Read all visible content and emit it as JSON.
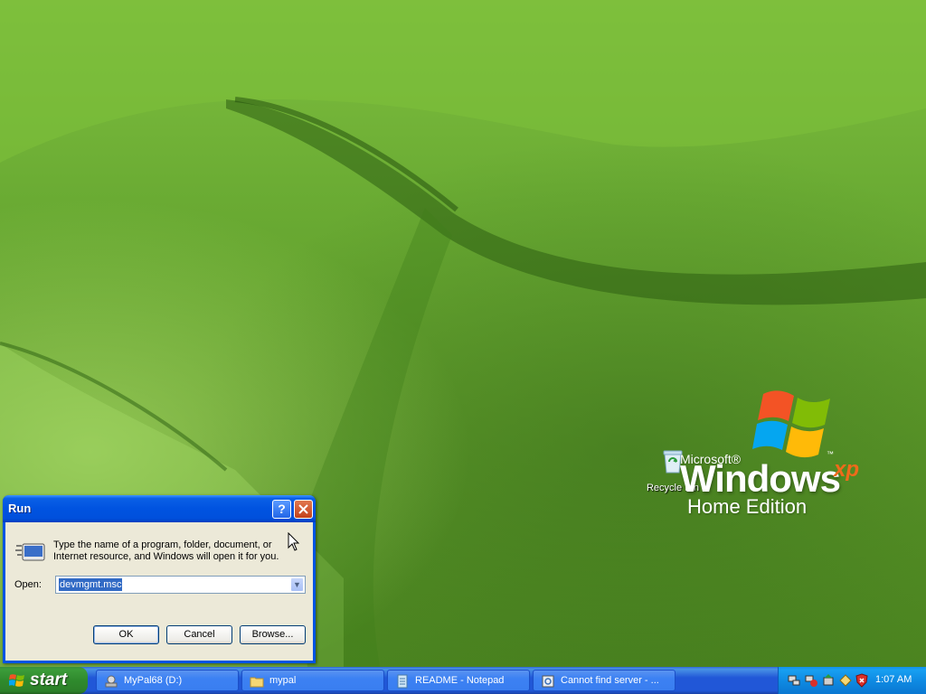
{
  "desktop": {
    "icons": [
      {
        "label": "Recycle Bin",
        "icon": "recycle-bin-icon"
      }
    ],
    "logo": {
      "microsoft": "Microsoft®",
      "windows": "Windows",
      "tm": "™",
      "xp": "xp",
      "edition": "Home Edition"
    }
  },
  "run_dialog": {
    "title": "Run",
    "help_label": "?",
    "description": "Type the name of a program, folder, document, or Internet resource, and Windows will open it for you.",
    "open_label": "Open:",
    "open_value": "devmgmt.msc",
    "buttons": {
      "ok": "OK",
      "cancel": "Cancel",
      "browse": "Browse..."
    }
  },
  "taskbar": {
    "start_label": "start",
    "tasks": [
      {
        "label": "MyPal68 (D:)",
        "icon": "drive-icon"
      },
      {
        "label": "mypal",
        "icon": "folder-icon"
      },
      {
        "label": "README - Notepad",
        "icon": "notepad-icon"
      },
      {
        "label": "Cannot find server - ...",
        "icon": "browser-icon"
      }
    ],
    "tray_icons": [
      "network-icon",
      "network-alert-icon",
      "safely-remove-icon",
      "update-icon",
      "security-center-icon"
    ],
    "clock": "1:07 AM"
  },
  "colors": {
    "titlebar_blue": "#0054e3",
    "taskbar_blue": "#2157d7",
    "start_green": "#3c9c3a",
    "dialog_face": "#ece9d8"
  }
}
